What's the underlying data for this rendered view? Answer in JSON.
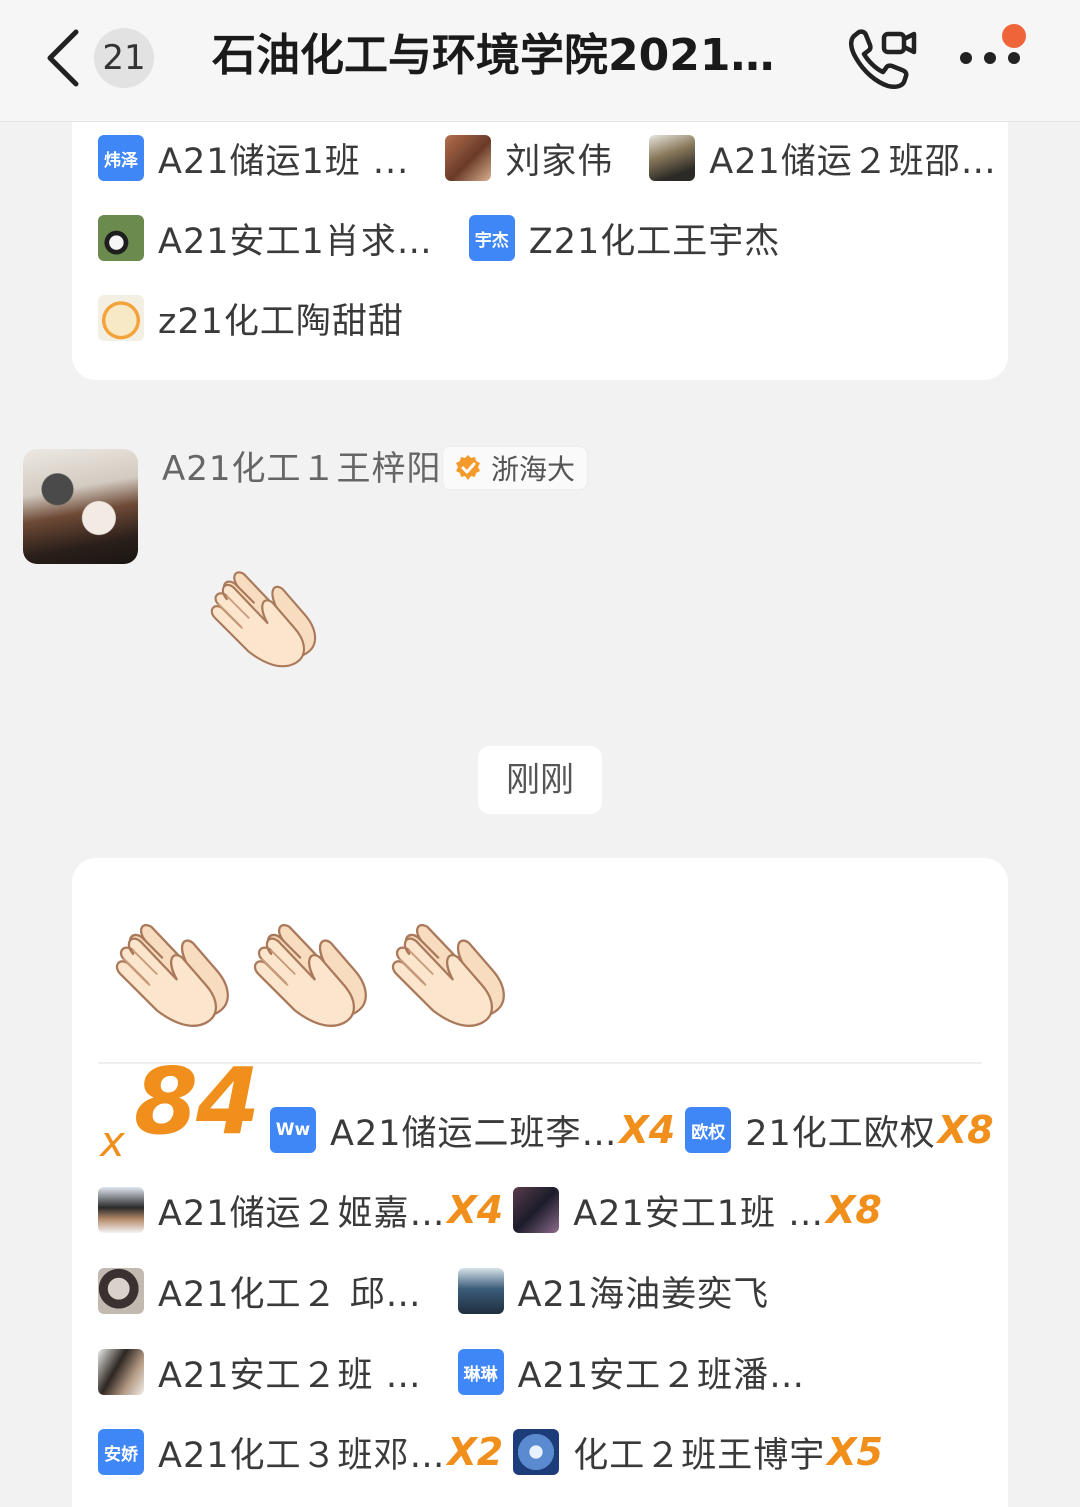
{
  "header": {
    "unread_count": "21",
    "title": "石油化工与环境学院2021…"
  },
  "top_card": {
    "rows": [
      [
        {
          "avatar_text": "炜泽",
          "name": "A21储运1班 ..."
        },
        {
          "avatar_text": "",
          "name": "刘家伟"
        },
        {
          "avatar_text": "",
          "name": "A21储运２班邵…"
        }
      ],
      [
        {
          "avatar_text": "",
          "name": "A21安工1肖求…"
        },
        {
          "avatar_text": "宇杰",
          "name": "Z21化工王宇杰"
        }
      ],
      [
        {
          "avatar_text": "",
          "name": "z21化工陶甜甜"
        }
      ]
    ]
  },
  "message": {
    "sender_name": "A21化工１王梓阳",
    "school_tag": "浙海大",
    "content_icon": "clapping-hands-emoji",
    "time_label": "刚刚"
  },
  "reactions": {
    "emoji": "clapping-hands-emoji",
    "total_prefix": "x",
    "total_count": "84",
    "rows": [
      [
        {
          "avatar_text": "Ww",
          "name": "A21储运二班李…",
          "mult": "X4"
        },
        {
          "avatar_text": "欧权",
          "name": "21化工欧权",
          "mult": "X8"
        }
      ],
      [
        {
          "avatar_text": "",
          "name": "A21储运２姬嘉…",
          "mult": "X4"
        },
        {
          "avatar_text": "",
          "name": "A21安工1班 …",
          "mult": "X8"
        }
      ],
      [
        {
          "avatar_text": "",
          "name": "A21化工２ 邱…",
          "mult": ""
        },
        {
          "avatar_text": "",
          "name": "A21海油姜奕飞",
          "mult": ""
        }
      ],
      [
        {
          "avatar_text": "",
          "name": "A21安工２班 …",
          "mult": ""
        },
        {
          "avatar_text": "琳琳",
          "name": "A21安工２班潘…",
          "mult": ""
        }
      ],
      [
        {
          "avatar_text": "安娇",
          "name": "A21化工３班邓…",
          "mult": "X2"
        },
        {
          "avatar_text": "",
          "name": "化工２班王博宇",
          "mult": "X5"
        }
      ]
    ]
  },
  "colors": {
    "accent_orange": "#f08f1c",
    "avatar_blue": "#3f86f7",
    "notification_dot": "#f0643a"
  }
}
